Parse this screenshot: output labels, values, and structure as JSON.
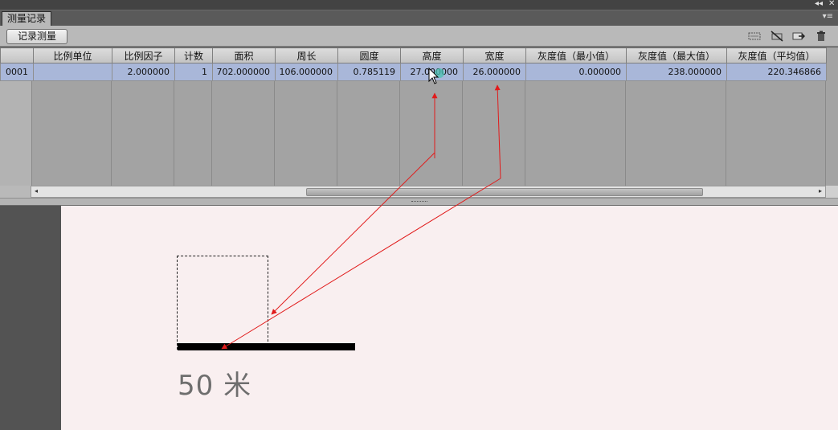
{
  "panel": {
    "tab_title": "测量记录",
    "collapse_icon": "double-chevron-left-icon",
    "close_icon": "close-icon",
    "menu_icon": "panel-menu-icon"
  },
  "toolbar": {
    "record_label": "记录测量",
    "icons": [
      "select-data-points-icon",
      "delete-data-points-icon",
      "export-icon",
      "trash-icon"
    ]
  },
  "table": {
    "columns": [
      "",
      "比例单位",
      "比例因子",
      "计数",
      "面积",
      "周长",
      "圆度",
      "高度",
      "宽度",
      "灰度值（最小值）",
      "灰度值（最大值）",
      "灰度值（平均值）"
    ],
    "rows": [
      [
        "0001",
        "",
        "2.000000",
        "1",
        "702.000000",
        "106.000000",
        "0.785119",
        "27.000000",
        "26.000000",
        "0.000000",
        "238.000000",
        "220.346866"
      ]
    ]
  },
  "canvas": {
    "scale_label": "50 米",
    "arrow_color": "#e11b1b",
    "selected_row_color": "#a9b7d9"
  }
}
